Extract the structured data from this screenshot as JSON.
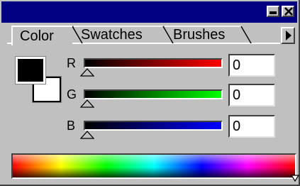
{
  "window": {
    "minimize_icon": "minimize-icon",
    "close_icon": "close-icon",
    "title_color": "#000080"
  },
  "tabs": [
    {
      "label": "Color",
      "active": true
    },
    {
      "label": "Swatches",
      "active": false
    },
    {
      "label": "Brushes",
      "active": false
    }
  ],
  "menu_arrow_icon": "panel-menu-arrow-icon",
  "colors": {
    "foreground": "#000000",
    "background": "#ffffff"
  },
  "channels": [
    {
      "label": "R",
      "value": "0",
      "gradient_end": "#ff0000"
    },
    {
      "label": "G",
      "value": "0",
      "gradient_end": "#00ff00"
    },
    {
      "label": "B",
      "value": "0",
      "gradient_end": "#0000ff"
    }
  ],
  "spectrum": {
    "name": "color-ramp"
  }
}
